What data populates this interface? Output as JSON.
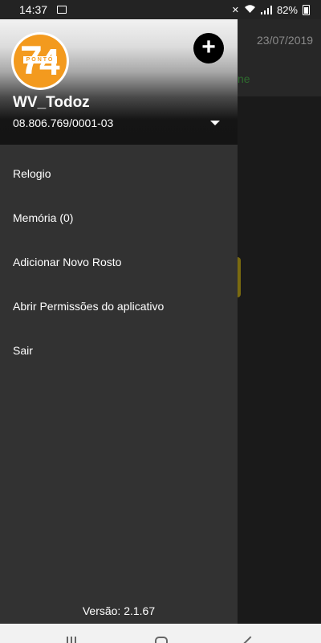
{
  "status_bar": {
    "time": "14:37",
    "battery": "82%",
    "icons": [
      "image-icon",
      "mute-icon",
      "wifi-icon",
      "signal-icon",
      "battery-icon"
    ]
  },
  "background_app": {
    "date": "23/07/2019",
    "green_text": "ne"
  },
  "drawer": {
    "header": {
      "logo_text": "PONTO",
      "logo_numbers": "74",
      "username": "WV_Todoz",
      "cnpj": "08.806.769/0001-03",
      "add_icon": "plus-icon",
      "dropdown_icon": "caret-down-icon"
    },
    "menu": [
      {
        "label": "Relogio"
      },
      {
        "label": "Memória (0)"
      },
      {
        "label": "Adicionar Novo Rosto"
      },
      {
        "label": "Abrir Permissões do aplicativo"
      },
      {
        "label": "Sair"
      }
    ],
    "version": "Versão: 2.1.67"
  },
  "colors": {
    "drawer_bg": "#323232",
    "logo_orange": "#f39a1e",
    "accent_green": "#2e6b2e"
  }
}
